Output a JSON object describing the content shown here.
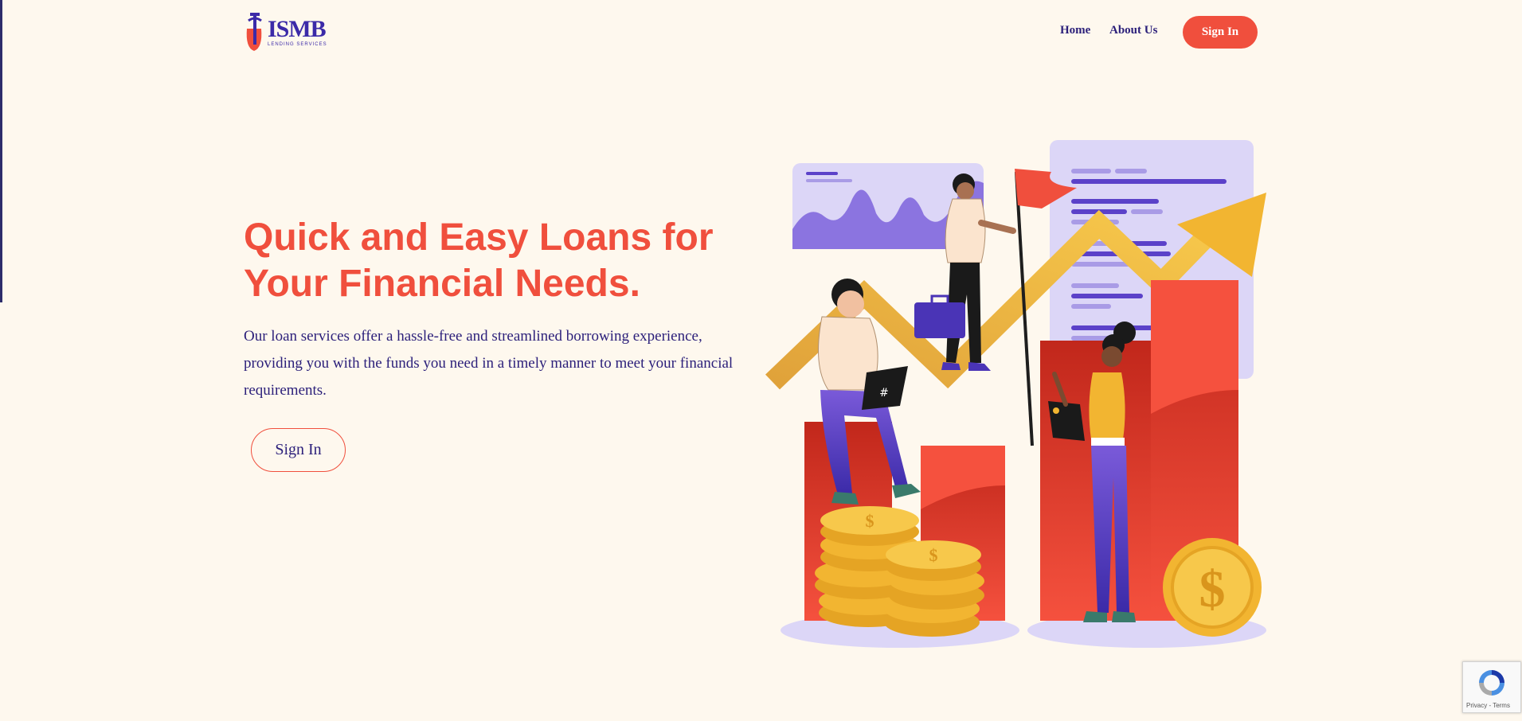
{
  "header": {
    "logo": {
      "name": "ISMB",
      "tagline": "LENDING SERVICES"
    },
    "nav": {
      "home": "Home",
      "about": "About Us",
      "signin": "Sign In"
    }
  },
  "hero": {
    "title": "Quick and Easy Loans for Your Financial Needs.",
    "text": "Our loan services offer a hassle-free and streamlined borrowing experience, providing you with the funds you need in a timely manner to meet your financial requirements.",
    "cta": "Sign In"
  },
  "recaptcha": {
    "terms": "Privacy - Terms"
  },
  "colors": {
    "background": "#fef8ee",
    "accent": "#f04f3d",
    "brand": "#2b1f7a",
    "gold": "#f2b531",
    "lavender": "#dcd6f7"
  }
}
